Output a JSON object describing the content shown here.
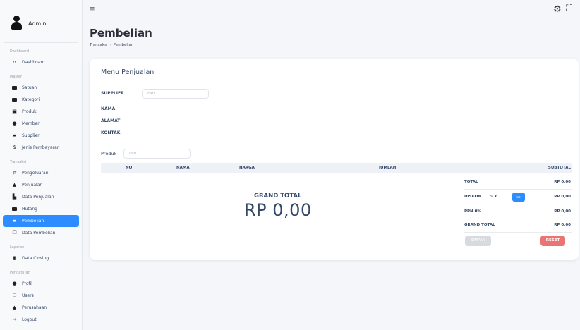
{
  "user": {
    "name": "Admin"
  },
  "sidebar": {
    "sections": [
      {
        "label": "Dashboard",
        "items": [
          {
            "label": "Dashboard",
            "icon": "home-icon"
          }
        ]
      },
      {
        "label": "Master",
        "items": [
          {
            "label": "Satuan",
            "icon": "folder-icon"
          },
          {
            "label": "Kategori",
            "icon": "folder-open-icon"
          },
          {
            "label": "Produk",
            "icon": "box-icon"
          },
          {
            "label": "Member",
            "icon": "user-icon"
          },
          {
            "label": "Supplier",
            "icon": "truck-icon"
          },
          {
            "label": "Jenis Pembayaran",
            "icon": "dollar-icon"
          }
        ]
      },
      {
        "label": "Transaksi",
        "items": [
          {
            "label": "Pengeluaran",
            "icon": "exchange-icon"
          },
          {
            "label": "Penjualan",
            "icon": "cart-icon"
          },
          {
            "label": "Data Penjualan",
            "icon": "chart-icon"
          },
          {
            "label": "Hutang",
            "icon": "card-icon"
          },
          {
            "label": "Pembelian",
            "icon": "truck-icon",
            "active": true
          },
          {
            "label": "Data Pembelian",
            "icon": "copy-icon"
          }
        ]
      },
      {
        "label": "Laporan",
        "items": [
          {
            "label": "Data Closing",
            "icon": "file-icon"
          }
        ]
      },
      {
        "label": "Pengaturan",
        "items": [
          {
            "label": "Profil",
            "icon": "users-icon"
          },
          {
            "label": "Users",
            "icon": "users-cog-icon"
          },
          {
            "label": "Perusahaan",
            "icon": "building-icon"
          },
          {
            "label": "Logout",
            "icon": "logout-icon"
          }
        ]
      }
    ]
  },
  "header": {
    "menu_icon": "≡"
  },
  "page": {
    "title": "Pembelian",
    "breadcrumb": [
      "Transaksi",
      "Pembelian"
    ]
  },
  "card": {
    "title": "Menu Penjualan",
    "supplier": {
      "label": "SUPPLIER",
      "placeholder": "cari.."
    },
    "nama": {
      "label": "NAMA",
      "value": "-"
    },
    "alamat": {
      "label": "ALAMAT",
      "value": "-"
    },
    "kontak": {
      "label": "KONTAK",
      "value": "-"
    },
    "produk": {
      "label": "Produk",
      "placeholder": "cari.."
    },
    "table": {
      "columns": [
        "NO",
        "NAMA",
        "HARGA",
        "JUMLAH",
        "SUBTOTAL"
      ]
    },
    "grand_total_label": "GRAND TOTAL",
    "grand_total_value": "RP 0,00",
    "summary": {
      "total": {
        "label": "TOTAL",
        "value": "RP 0,00"
      },
      "diskon": {
        "label": "DISKON",
        "unit": "%",
        "value": "RP 0,00"
      },
      "ppn": {
        "label": "PPN 0%",
        "value": "RP 0,00"
      },
      "grand": {
        "label": "GRAND TOTAL",
        "value": "RP 0,00"
      }
    },
    "buttons": {
      "simpan": "SIMPAN",
      "reset": "RESET"
    }
  }
}
